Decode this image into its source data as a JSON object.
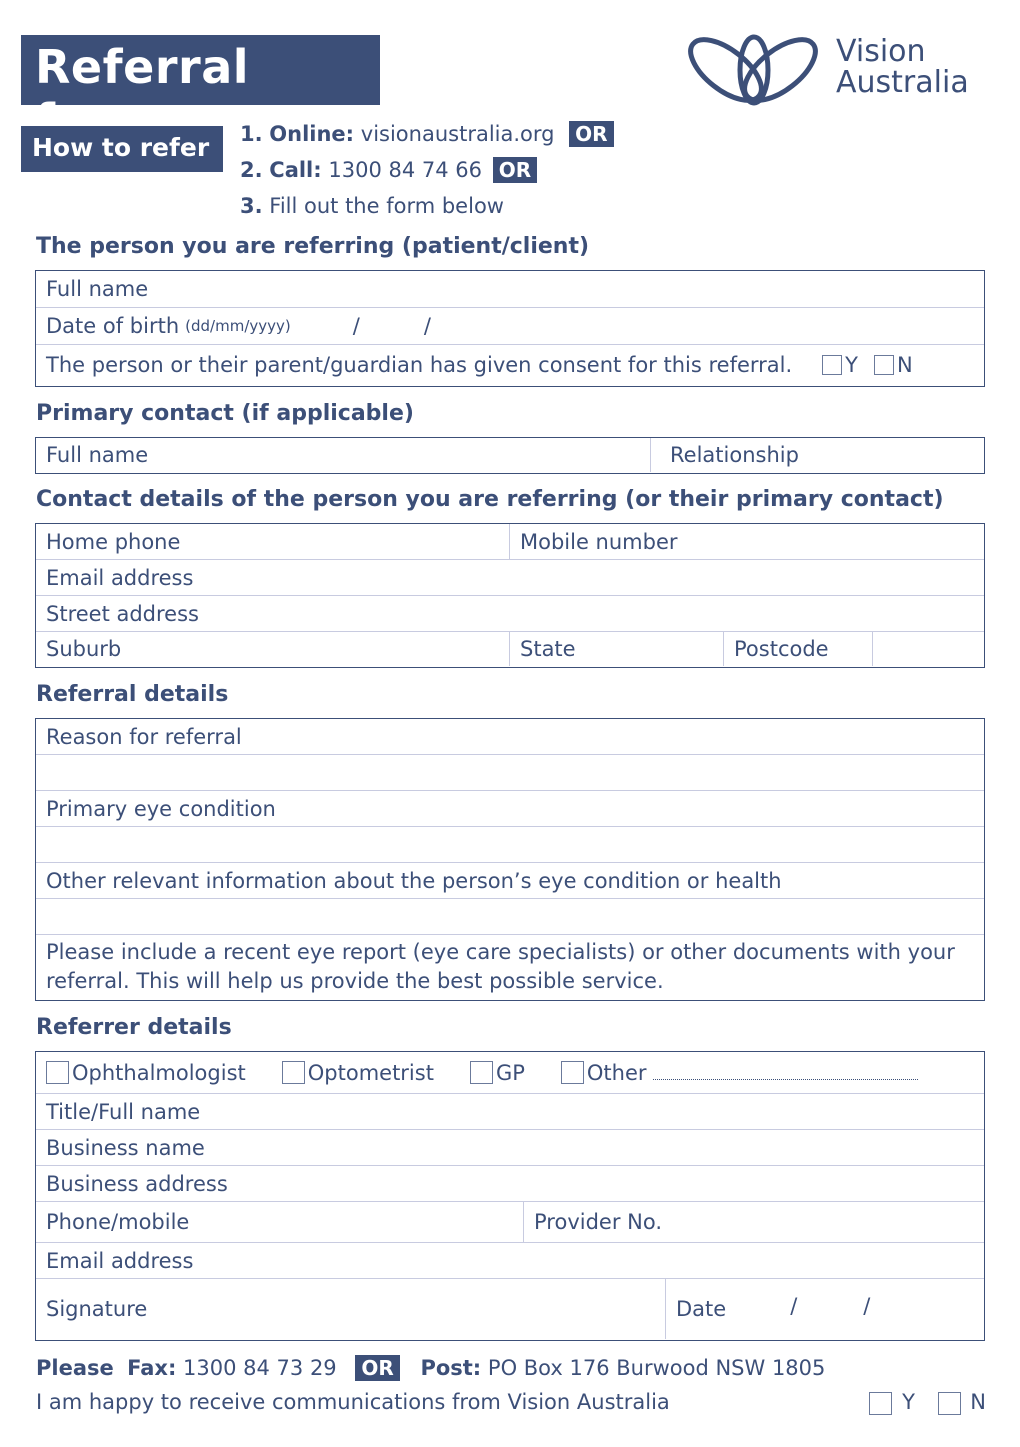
{
  "header": {
    "title": "Referral form",
    "logo": {
      "line1": "Vision",
      "line2": "Australia",
      "icon": "vision-australia-logo-icon"
    }
  },
  "how_to_refer": {
    "label": "How to refer",
    "steps": [
      {
        "num": "1.",
        "label": "Online:",
        "value": "visionaustralia.org",
        "badge": "OR"
      },
      {
        "num": "2.",
        "label": "Call:",
        "value": "1300 84 74 66",
        "badge": "OR"
      },
      {
        "num": "3.",
        "label": "",
        "value": "Fill out the form below",
        "badge": ""
      }
    ]
  },
  "patient": {
    "heading": "The person you are referring (patient/client)",
    "full_name": "Full name",
    "dob_label": "Date of birth",
    "dob_format": "(dd/mm/yyyy)",
    "date_sep": "/",
    "consent": "The person or their parent/guardian has given consent for this referral.",
    "yes": "Y",
    "no": "N"
  },
  "primary_contact": {
    "heading": "Primary contact (if applicable)",
    "full_name": "Full name",
    "relationship": "Relationship"
  },
  "contact_details": {
    "heading": "Contact details of the person you are referring (or their primary contact)",
    "home_phone": "Home phone",
    "mobile": "Mobile number",
    "email": "Email address",
    "street": "Street address",
    "suburb": "Suburb",
    "state": "State",
    "postcode": "Postcode"
  },
  "referral_details": {
    "heading": "Referral details",
    "reason": "Reason for referral",
    "eye_condition": "Primary eye condition",
    "other_info": "Other relevant information about the person’s eye condition or health",
    "note": "Please include a recent eye report (eye care specialists) or other documents with your referral. This will help us provide the best possible service."
  },
  "referrer": {
    "heading": "Referrer details",
    "types": [
      "Ophthalmologist",
      "Optometrist",
      "GP",
      "Other"
    ],
    "title_name": "Title/Full name",
    "business_name": "Business name",
    "business_address": "Business address",
    "phone": "Phone/mobile",
    "provider_no": "Provider No.",
    "email": "Email address",
    "signature": "Signature",
    "date": "Date",
    "date_sep": "/"
  },
  "footer": {
    "please": "Please",
    "fax_label": "Fax:",
    "fax_value": "1300 84 73 29",
    "or": "OR",
    "post_label": "Post:",
    "post_value": "PO Box 176 Burwood NSW 1805",
    "comms": "I am happy to receive communications from Vision Australia",
    "yes": "Y",
    "no": "N"
  }
}
